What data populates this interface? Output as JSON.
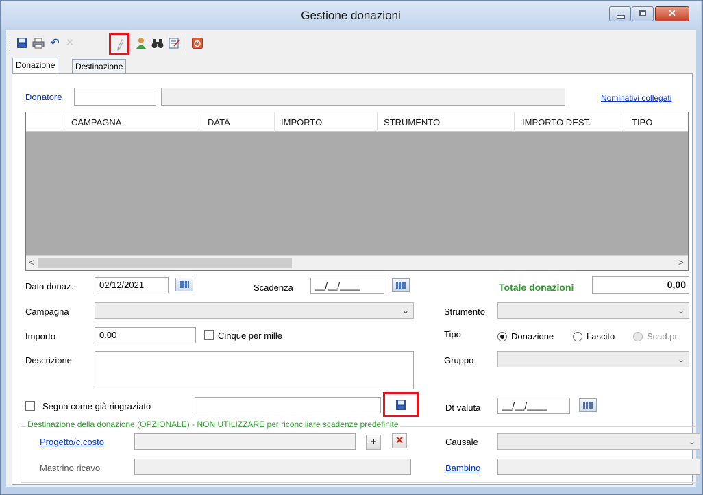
{
  "window": {
    "title": "Gestione donazioni",
    "close_glyph": "✕"
  },
  "tabs": [
    {
      "label": "Donazione"
    },
    {
      "label": "Destinazione"
    }
  ],
  "donor": {
    "link": "Donatore",
    "code": "",
    "name": "",
    "related_link": "Nominativi collegati"
  },
  "grid": {
    "columns": [
      "CAMPAGNA",
      "DATA",
      "IMPORTO",
      "STRUMENTO",
      "IMPORTO DEST.",
      "TIPO"
    ],
    "scroll_left": "<",
    "scroll_right": ">"
  },
  "form": {
    "date_label": "Data donaz.",
    "date_value": "02/12/2021",
    "due_label": "Scadenza",
    "due_value": "__/__/____",
    "total_label": "Totale donazioni",
    "total_value": "0,00",
    "campaign_label": "Campagna",
    "instrument_label": "Strumento",
    "amount_label": "Importo",
    "amount_value": "0,00",
    "five_per_thousand_label": "Cinque per mille",
    "type_label": "Tipo",
    "type_options": [
      "Donazione",
      "Lascito",
      "Scad.pr."
    ],
    "description_label": "Descrizione",
    "group_label": "Gruppo",
    "thanked_label": "Segna come già ringraziato",
    "value_date_label": "Dt valuta",
    "value_date_value": "__/__/____"
  },
  "destination": {
    "legend": "Destinazione della donazione (OPZIONALE) - NON UTILIZZARE per riconciliare scadenze predefinite",
    "project_link": "Progetto/c.costo",
    "add_glyph": "+",
    "remove_glyph": "✕",
    "reason_label": "Causale",
    "ledger_label": "Mastrino ricavo",
    "child_link": "Bambino"
  },
  "colors": {
    "accent_green": "#2ca02c",
    "link_blue": "#0033cc",
    "highlight_red": "#e8141c"
  }
}
